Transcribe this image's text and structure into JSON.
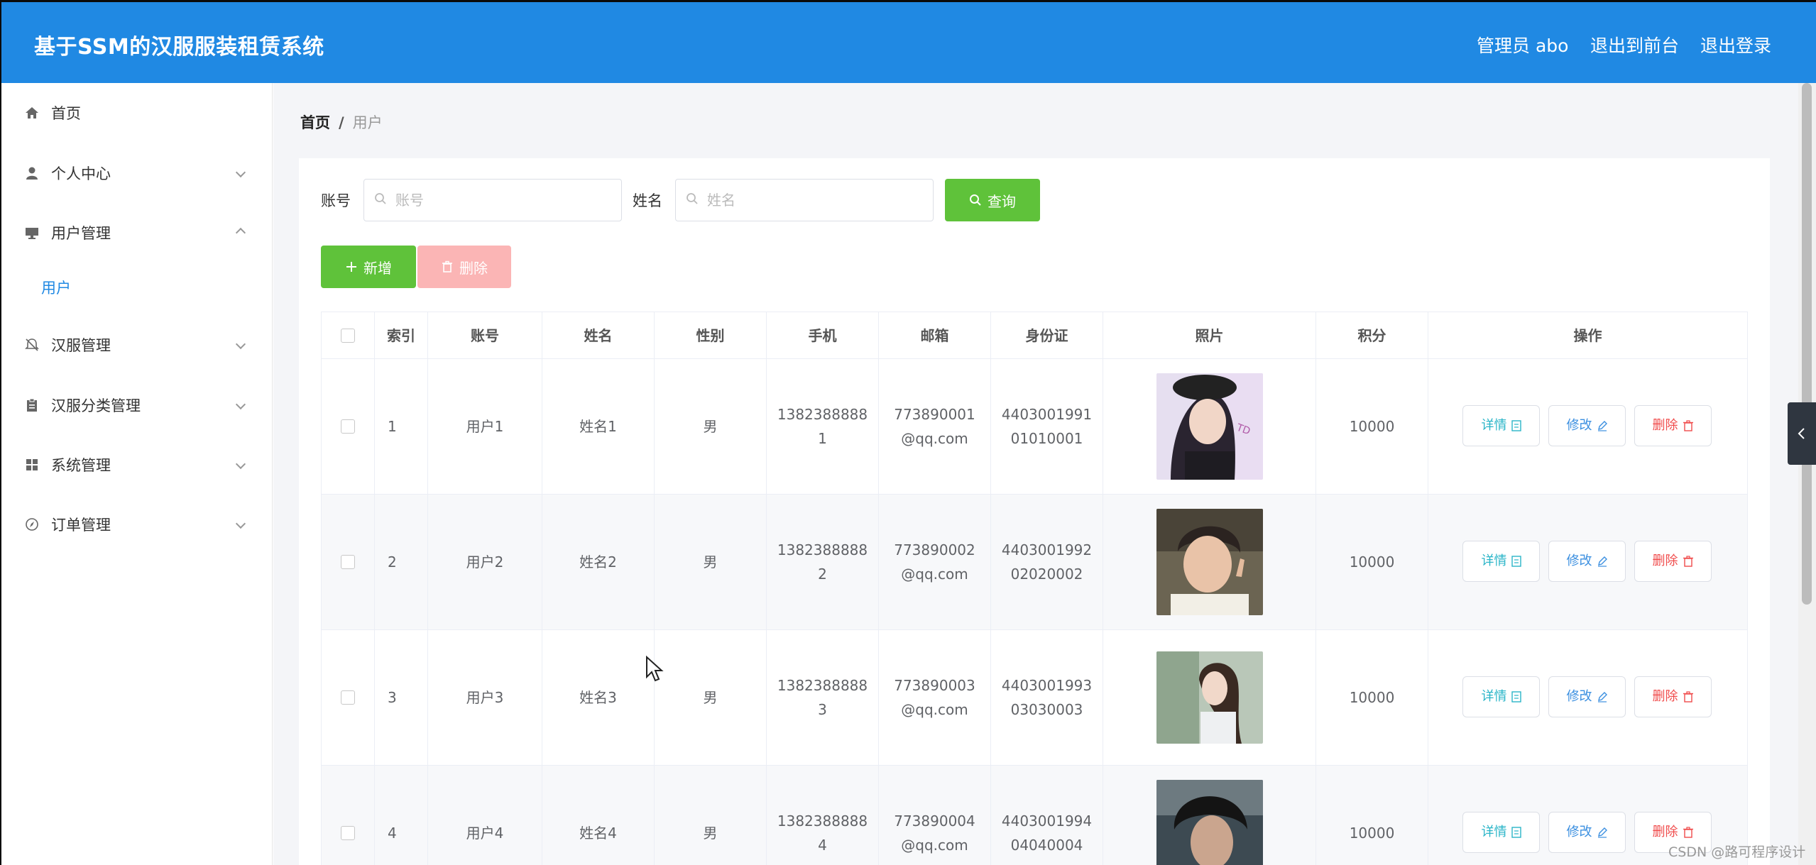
{
  "header": {
    "title": "基于SSM的汉服服装租赁系统",
    "admin": "管理员 abo",
    "to_front": "退出到前台",
    "logout": "退出登录"
  },
  "sidebar": {
    "items": [
      {
        "label": "首页",
        "icon": "home-icon"
      },
      {
        "label": "个人中心",
        "icon": "user-icon"
      },
      {
        "label": "用户管理",
        "icon": "monitor-icon"
      },
      {
        "label": "用户",
        "icon": ""
      },
      {
        "label": "汉服管理",
        "icon": "bell-off-icon"
      },
      {
        "label": "汉服分类管理",
        "icon": "clipboard-icon"
      },
      {
        "label": "系统管理",
        "icon": "grid-icon"
      },
      {
        "label": "订单管理",
        "icon": "compass-icon"
      }
    ]
  },
  "breadcrumb": {
    "home": "首页",
    "sep": "/",
    "current": "用户"
  },
  "search": {
    "account_label": "账号",
    "account_placeholder": "账号",
    "name_label": "姓名",
    "name_placeholder": "姓名",
    "query_button": "查询"
  },
  "actions": {
    "add": "新增",
    "delete": "删除"
  },
  "table": {
    "headers": [
      "",
      "索引",
      "账号",
      "姓名",
      "性别",
      "手机",
      "邮箱",
      "身份证",
      "照片",
      "积分",
      "操作"
    ],
    "rows": [
      {
        "index": "1",
        "account": "用户1",
        "name": "姓名1",
        "gender": "男",
        "phone_a": "1382388888",
        "phone_b": "1",
        "email_a": "773890001",
        "email_b": "@qq.com",
        "id_a": "4403001991",
        "id_b": "01010001",
        "points": "10000"
      },
      {
        "index": "2",
        "account": "用户2",
        "name": "姓名2",
        "gender": "男",
        "phone_a": "1382388888",
        "phone_b": "2",
        "email_a": "773890002",
        "email_b": "@qq.com",
        "id_a": "4403001992",
        "id_b": "02020002",
        "points": "10000"
      },
      {
        "index": "3",
        "account": "用户3",
        "name": "姓名3",
        "gender": "男",
        "phone_a": "1382388888",
        "phone_b": "3",
        "email_a": "773890003",
        "email_b": "@qq.com",
        "id_a": "4403001993",
        "id_b": "03030003",
        "points": "10000"
      },
      {
        "index": "4",
        "account": "用户4",
        "name": "姓名4",
        "gender": "男",
        "phone_a": "1382388888",
        "phone_b": "4",
        "email_a": "773890004",
        "email_b": "@qq.com",
        "id_a": "4403001994",
        "id_b": "04040004",
        "points": "10000"
      }
    ],
    "row_actions": {
      "detail": "详情",
      "edit": "修改",
      "delete": "删除"
    }
  },
  "colors": {
    "header": "#2089e3",
    "green": "#5fc23a",
    "pink": "#fbb5b5",
    "accent": "#2089e3"
  },
  "watermark": "CSDN @路可程序设计"
}
